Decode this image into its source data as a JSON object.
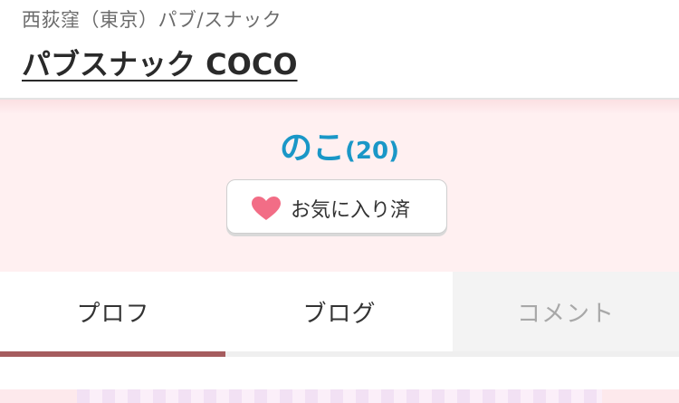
{
  "header": {
    "area_category": "西荻窪（東京）パブ/スナック",
    "shop_name": "パブスナック COCO"
  },
  "profile": {
    "name": "のこ",
    "age": "(20)",
    "favorite_label": "お気に入り済",
    "heart_color": "#f26d86"
  },
  "tabs": [
    {
      "label": "プロフ",
      "active": true
    },
    {
      "label": "ブログ",
      "active": false
    },
    {
      "label": "コメント",
      "active": false,
      "disabled": true
    }
  ],
  "colors": {
    "name_color": "#1a97c7",
    "profile_bg": "#fff0f1",
    "active_tab_indicator": "#a55c5e"
  }
}
